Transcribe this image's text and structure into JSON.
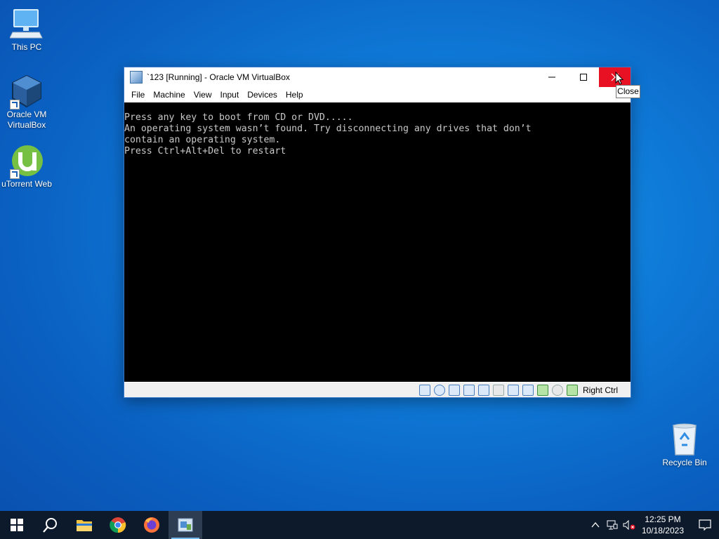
{
  "desktop": {
    "icons": [
      {
        "label": "This PC",
        "icon": "computer-icon"
      },
      {
        "label": "Oracle VM VirtualBox",
        "icon": "virtualbox-icon"
      },
      {
        "label": "uTorrent Web",
        "icon": "utorrent-icon"
      },
      {
        "label": "Recycle Bin",
        "icon": "recycle-bin-icon"
      }
    ]
  },
  "window": {
    "title": "`123 [Running] - Oracle VM VirtualBox",
    "menu": [
      "File",
      "Machine",
      "View",
      "Input",
      "Devices",
      "Help"
    ],
    "console_lines": [
      "Press any key to boot from CD or DVD.....",
      "An operating system wasn’t found. Try disconnecting any drives that don’t",
      "contain an operating system.",
      "Press Ctrl+Alt+Del to restart"
    ],
    "status": {
      "host_key": "Right Ctrl",
      "icons": [
        "hard-disk-icon",
        "optical-drive-icon",
        "audio-icon",
        "network-icon",
        "usb-icon",
        "shared-folders-icon",
        "display-icon",
        "video-capture-icon",
        "cpu-icon",
        "mouse-integration-icon",
        "keyboard-capture-icon"
      ]
    },
    "close_tooltip": "Close"
  },
  "taskbar": {
    "apps": [
      "start-icon",
      "search-icon",
      "file-explorer-icon",
      "chrome-icon",
      "firefox-icon",
      "virtualbox-icon"
    ],
    "time": "12:25 PM",
    "date": "10/18/2023"
  },
  "colors": {
    "accent": "#0a5fc0",
    "close_red": "#e81123",
    "taskbar": "#0d1a2b"
  }
}
